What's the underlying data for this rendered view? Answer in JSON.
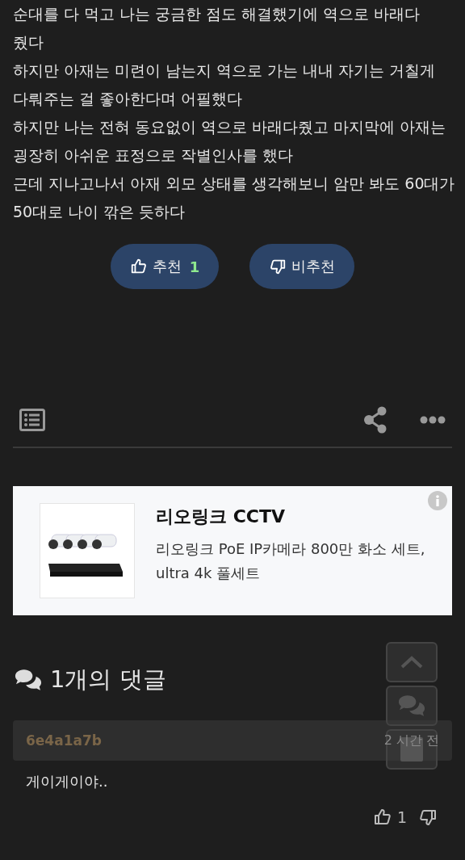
{
  "article": {
    "paragraphs": [
      "순대를 다 먹고 나는 궁금한 점도 해결했기에 역으로 바래다 줬다",
      "하지만 아재는 미련이 남는지 역으로 가는 내내 자기는 거칠게 다뤄주는 걸 좋아한다며 어필했다",
      "하지만 나는 전혀 동요없이 역으로 바래다줬고 마지막에 아재는 굉장히 아쉬운 표정으로 작별인사를 했다",
      "근데 지나고나서 아재 외모 상태를 생각해보니 암만 봐도 60대가 50대로 나이 깎은 듯하다"
    ]
  },
  "votes": {
    "up_label": "추천",
    "up_count": "1",
    "down_label": "비추천"
  },
  "ad": {
    "title": "리오링크 CCTV",
    "description": "리오링크 PoE IP카메라 800만 화소 세트, ultra 4k 풀세트"
  },
  "comments": {
    "heading": "1개의 댓글",
    "items": [
      {
        "author": "6e4a1a7b",
        "time": "2 시간 전",
        "text": "게이게이야..",
        "likes": "1"
      }
    ]
  }
}
